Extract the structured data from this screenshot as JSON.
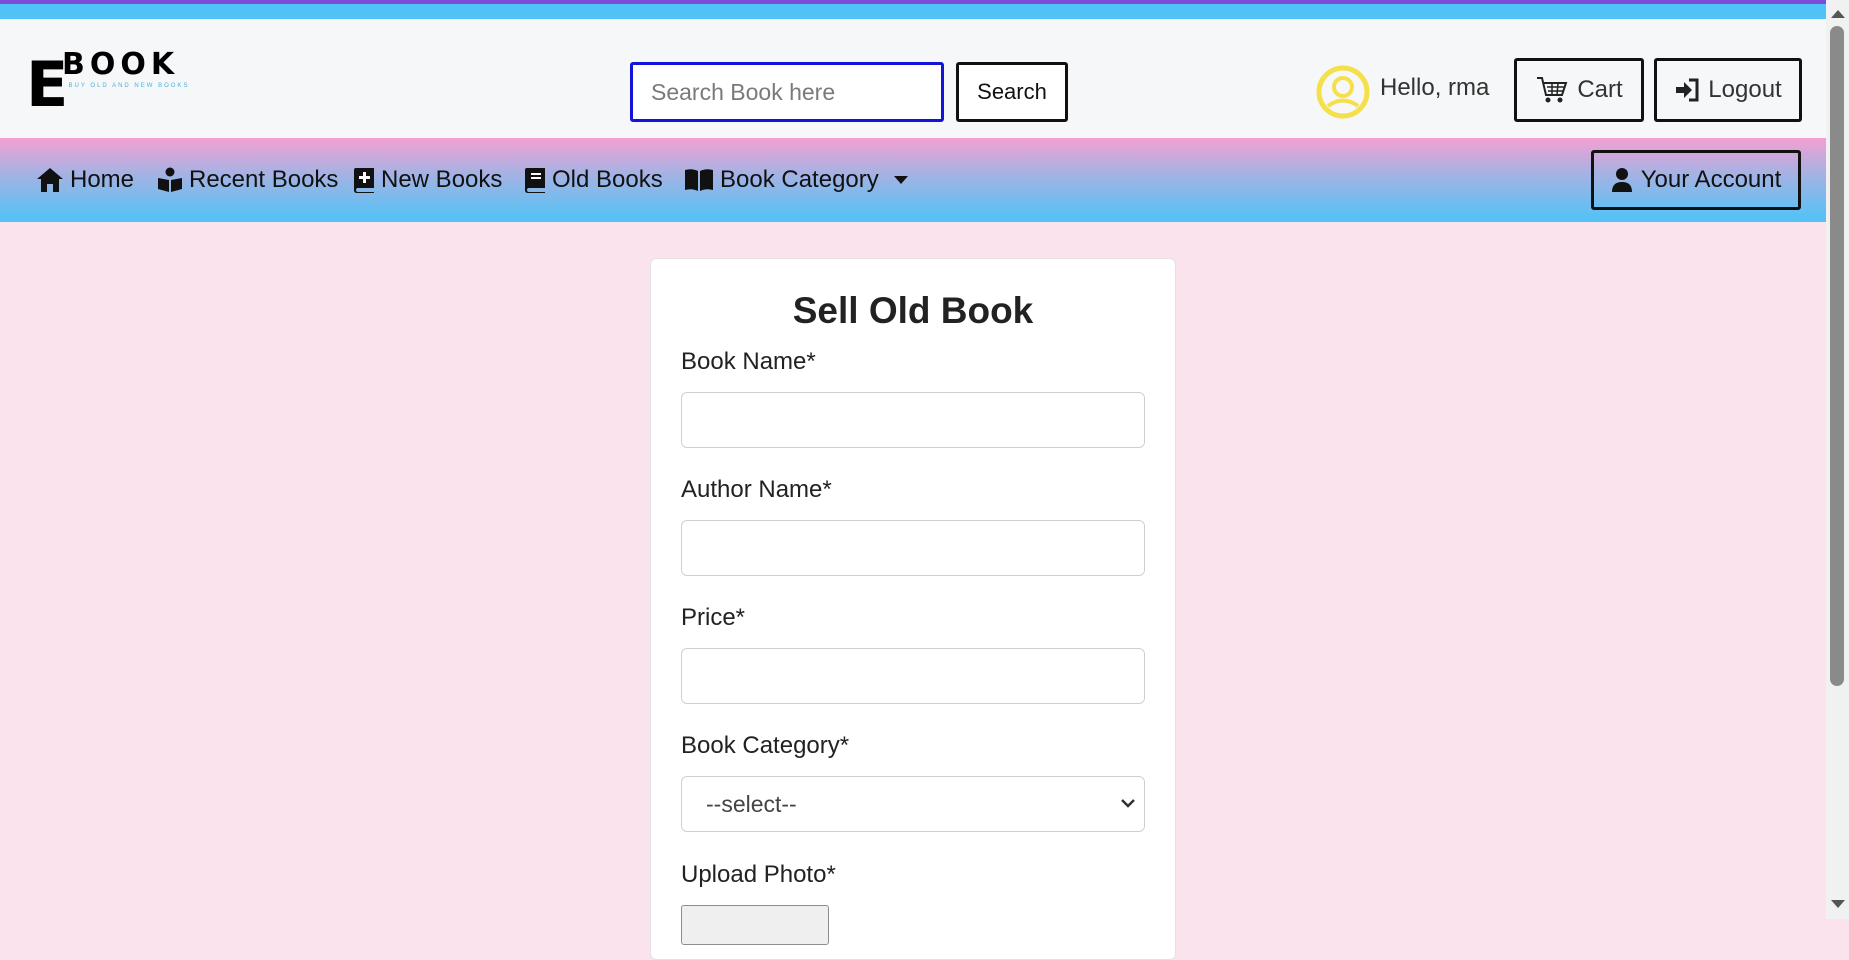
{
  "logo": {
    "letter": "E",
    "word": "BOOK",
    "tagline": "BUY OLD AND NEW BOOKS"
  },
  "header": {
    "search_placeholder": "Search Book here",
    "search_button": "Search",
    "greeting": "Hello, rma",
    "cart_label": "Cart",
    "logout_label": "Logout"
  },
  "nav": {
    "items": [
      {
        "label": "Home",
        "icon": "home-icon"
      },
      {
        "label": "Recent Books",
        "icon": "book-reader-icon"
      },
      {
        "label": "New Books",
        "icon": "book-medical-icon"
      },
      {
        "label": "Old Books",
        "icon": "book-icon"
      },
      {
        "label": "Book Category",
        "icon": "book-open-icon"
      }
    ],
    "account_label": "Your Account"
  },
  "form": {
    "title": "Sell Old Book",
    "book_name_label": "Book Name*",
    "book_name_value": "",
    "author_name_label": "Author Name*",
    "author_name_value": "",
    "price_label": "Price*",
    "price_value": "",
    "category_label": "Book Category*",
    "category_selected": "--select--",
    "upload_label": "Upload Photo*"
  },
  "colors": {
    "accent_top": "#7c4bd8",
    "strip": "#4fc3f7",
    "nav_gradient_top": "#f4a0d3",
    "nav_gradient_bottom": "#4fc3f7",
    "page_bg": "#fae3ec",
    "search_border": "#1414d8",
    "user_icon": "#f5e04a"
  }
}
